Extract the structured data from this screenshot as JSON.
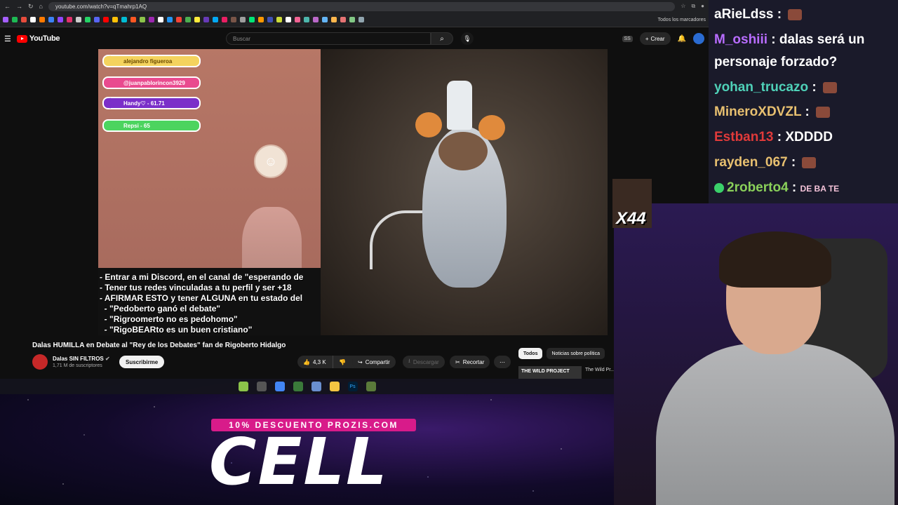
{
  "browser": {
    "url": "youtube.com/watch?v=qTmahrp1AQ",
    "bookmarks_label": "Todos los marcadores"
  },
  "youtube": {
    "logo": "YouTube",
    "search_placeholder": "Buscar",
    "create_label": "Crear",
    "cast_label": "SS",
    "avatar_label": "YouTube"
  },
  "video": {
    "donors": [
      {
        "name": "alejandro figueroa",
        "color": "#f4d35e",
        "text_color": "#6b4a00",
        "icon": "♛"
      },
      {
        "name": "@juanpablorincon3929",
        "color": "#e94b8f",
        "text_color": "#ffffff",
        "icon": "♥"
      },
      {
        "name": "Handy♡ - 61.71",
        "color": "#7b2fc9",
        "text_color": "#ffffff",
        "icon": "$"
      },
      {
        "name": "Repsi - 65",
        "color": "#4cd45f",
        "text_color": "#ffffff",
        "icon": "€"
      }
    ],
    "rules": [
      "- Entrar a mi Discord, en el canal de \"esperando de",
      "- Tener tus redes vinculadas a tu perfil y ser +18",
      "- AFIRMAR ESTO y tener ALGUNA en tu estado del",
      "  - \"Pedoberto ganó el debate\"",
      "  - \"Rigroomerto no es pedohomo\"",
      "  - \"RigoBEARto es un buen cristiano\""
    ]
  },
  "watch": {
    "title": "Dalas HUMILLA en Debate al \"Rey de los Debates\" fan de Rigoberto Hidalgo",
    "channel_name": "Dalas SIN FILTROS",
    "subscribers": "1,71 M de suscriptores",
    "subscribe_label": "Suscribirme",
    "likes": "4,3 K",
    "share_label": "Compartir",
    "download_label": "Descargar",
    "clip_label": "Recortar",
    "chips": [
      "Todos",
      "Noticias sobre política"
    ],
    "rec_thumb_text": "THE WILD PROJECT",
    "rec_title": "The Wild Pr..."
  },
  "promo": {
    "code_text": "10% DESCUENTO PROZIS.COM",
    "big_text": "CELL"
  },
  "chat": {
    "messages": [
      {
        "user": "aRieLdss",
        "color": "#ffffff",
        "text": "",
        "emote": true
      },
      {
        "user": "M_oshiii",
        "color": "#b86cff",
        "text": "dalas será un",
        "emote": false
      },
      {
        "user": "",
        "color": "#ffffff",
        "text": "personaje forzado?",
        "emote": false
      },
      {
        "user": "yohan_trucazo",
        "color": "#4fd1b8",
        "text": "",
        "emote": true
      },
      {
        "user": "MineroXDVZL",
        "color": "#e8c070",
        "text": "",
        "emote": true
      },
      {
        "user": "Estban13",
        "color": "#e03a3a",
        "text": "XDDDD",
        "emote": false
      },
      {
        "user": "rayden_067",
        "color": "#e8c070",
        "text": "",
        "emote": true
      },
      {
        "user": "2roberto4",
        "color": "#8ad05a",
        "text": "DE BA TE",
        "emote": false
      }
    ],
    "multiplier": "X44"
  },
  "colors": {
    "yt_red": "#ff0000",
    "promo_pink": "#d81b8a"
  }
}
